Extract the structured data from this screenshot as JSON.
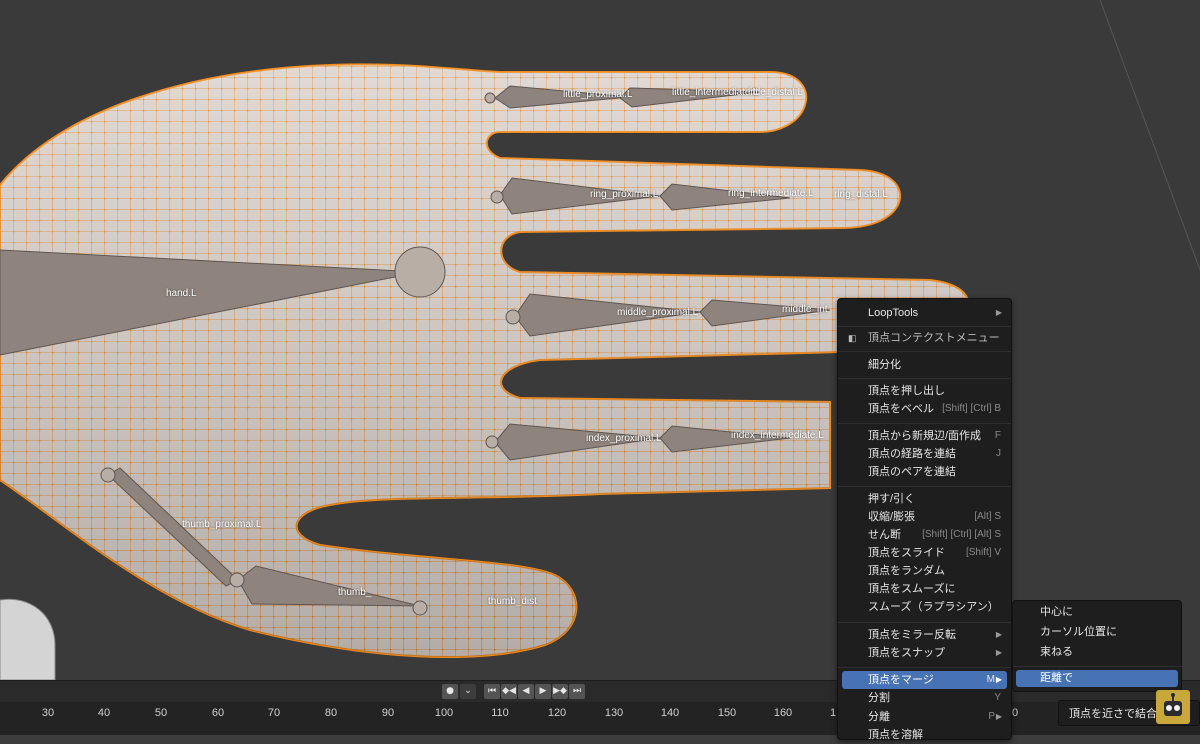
{
  "bone_labels": {
    "little_proximal": "little_proximal.L",
    "little_intermediate": "little_intermediate.L",
    "little_distal": "little_distal.L",
    "ring_proximal": "ring_proximal.L",
    "ring_intermediate": "ring_intermediate.L",
    "ring_distal": "ring_distal.L",
    "hand": "hand.L",
    "middle_proximal": "middle_proximal.L",
    "middle_intermediate": "middle_int",
    "index_proximal": "index_proximal.L",
    "index_intermediate": "index_intermediate.L",
    "thumb_proximal": "thumb_proximal.L",
    "thumb_intermediate": "thumb_",
    "thumb_distal": "thumb_dist"
  },
  "ruler": {
    "ticks": [
      "30",
      "40",
      "50",
      "60",
      "70",
      "80",
      "90",
      "100",
      "110",
      "120",
      "130",
      "140",
      "150",
      "160",
      "1",
      "0"
    ]
  },
  "playback": {
    "record": "●",
    "record_dropdown": "⌄",
    "jump_start": "⏮",
    "prev_key": "◆◀",
    "play_reverse": "◀",
    "play": "▶",
    "next_key": "▶◆",
    "jump_end": "⏭"
  },
  "context_menu": {
    "loop_tools": "LoopTools",
    "title": "頂点コンテクストメニュー",
    "subdivide": "細分化",
    "extrude": "頂点を押し出し",
    "bevel": "頂点をベベル",
    "bevel_shortcut": "[Shift] [Ctrl] B",
    "new_edge_face": "頂点から新規辺/面作成",
    "new_edge_face_shortcut": "F",
    "connect_path": "頂点の経路を連結",
    "connect_path_shortcut": "J",
    "connect_pairs": "頂点のペアを連結",
    "push_pull": "押す/引く",
    "shrink_fatten": "収縮/膨張",
    "shrink_fatten_shortcut": "[Alt] S",
    "shear": "せん断",
    "shear_shortcut": "[Shift] [Ctrl] [Alt] S",
    "slide": "頂点をスライド",
    "slide_shortcut": "[Shift] V",
    "randomize": "頂点をランダム",
    "smooth": "頂点をスムーズに",
    "smooth_laplacian": "スムーズ（ラプラシアン）",
    "mirror": "頂点をミラー反転",
    "snap": "頂点をスナップ",
    "merge": "頂点をマージ",
    "merge_shortcut": "M",
    "split": "分割",
    "split_shortcut": "Y",
    "separate": "分離",
    "separate_shortcut": "P",
    "dissolve": "頂点を溶解"
  },
  "merge_submenu": {
    "at_center": "中心に",
    "at_cursor": "カーソル位置に",
    "collapse": "束ねる",
    "by_distance": "距離で"
  },
  "tooltip": "頂点を近さで結合します",
  "colors": {
    "accent": "#4772b3",
    "selection": "#f08a1c",
    "mesh": "#d8cfc8"
  }
}
